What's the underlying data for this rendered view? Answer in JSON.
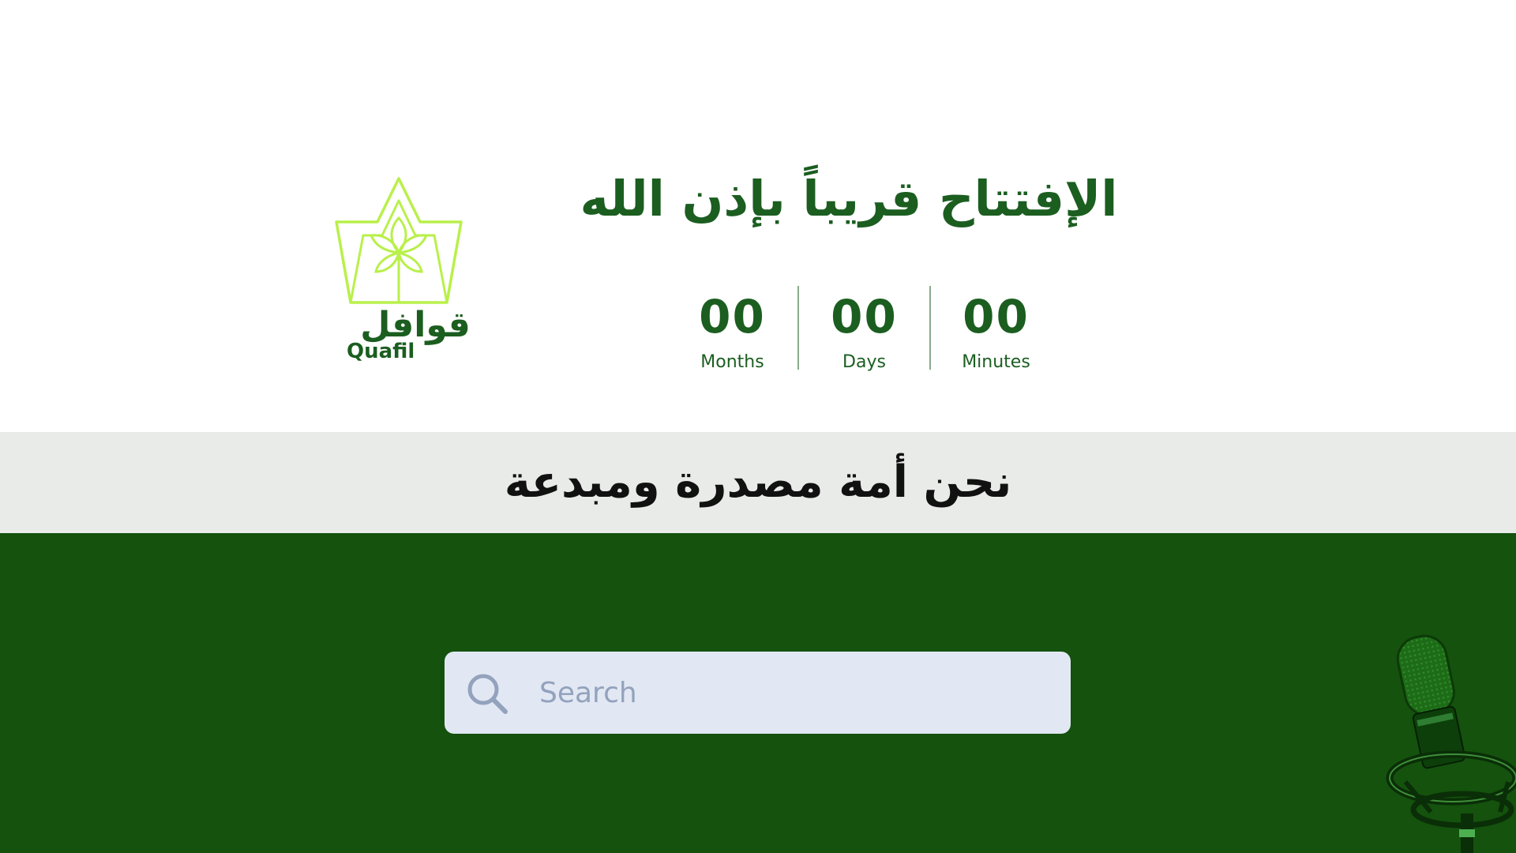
{
  "logo": {
    "arabic_text": "قوافل",
    "latin_text": "Quafil",
    "colors": {
      "outline": "#b9f04a",
      "text": "#1b5e20"
    },
    "icon": "crown-leaf-logo-icon"
  },
  "hero": {
    "headline": "الإفتتاح قريباً بإذن الله"
  },
  "countdown": {
    "items": [
      {
        "value": "00",
        "label": "Months"
      },
      {
        "value": "00",
        "label": "Days"
      },
      {
        "value": "00",
        "label": "Minutes"
      }
    ]
  },
  "slogan_band": {
    "text": "نحن أمة مصدرة ومبدعة"
  },
  "search": {
    "placeholder": "Search",
    "value": "",
    "icon": "search-icon"
  },
  "decoration": {
    "icon": "microphone-icon"
  },
  "colors": {
    "primary_green": "#1b5e20",
    "section_green": "#14520d",
    "band_gray": "#e9ebe9",
    "search_bg": "#e2e8f3",
    "accent_lime": "#b9f04a"
  }
}
